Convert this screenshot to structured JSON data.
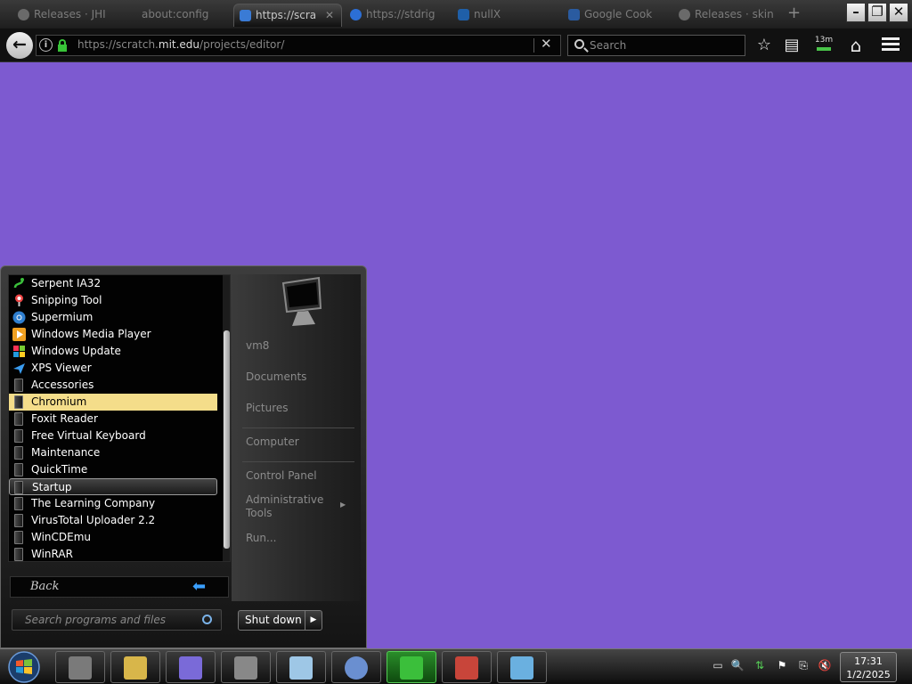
{
  "browser": {
    "tabs": [
      {
        "label": "Releases · JHI",
        "active": false,
        "icon_color": "#6a6a6a"
      },
      {
        "label": "about:config",
        "active": false,
        "icon_color": "#6a6a6a"
      },
      {
        "label": "https://scra",
        "active": true,
        "icon_color": "#3a7bd5"
      },
      {
        "label": "https://stdrig",
        "active": false,
        "icon_color": "#2c6fd6"
      },
      {
        "label": "nullX",
        "active": false,
        "icon_color": "#1f5fa8"
      },
      {
        "label": "Google Cook",
        "active": false,
        "icon_color": "#2a5ba0"
      },
      {
        "label": "Releases · skin",
        "active": false,
        "icon_color": "#6a6a6a"
      }
    ],
    "new_tab": "+",
    "window_controls": {
      "minimize": "–",
      "maximize": "❐",
      "close": "✕"
    },
    "nav": {
      "back": "←",
      "url_prefix": "https://scratch.",
      "url_host": "mit.edu",
      "url_path": "/projects/editor/",
      "clear": "✕",
      "search_placeholder": "Search",
      "bookmark": "☆",
      "reader": "▤",
      "timer_badge": "13m",
      "home": "⌂"
    }
  },
  "start_menu": {
    "programs": [
      {
        "label": "Serpent IA32",
        "icon": "serpent-icon"
      },
      {
        "label": "Snipping Tool",
        "icon": "scissors-icon"
      },
      {
        "label": "Supermium",
        "icon": "supermium-icon"
      },
      {
        "label": "Windows Media Player",
        "icon": "media-player-icon"
      },
      {
        "label": "Windows Update",
        "icon": "windows-update-icon"
      },
      {
        "label": "XPS Viewer",
        "icon": "xps-viewer-icon"
      },
      {
        "label": "Accessories",
        "icon": "folder-icon"
      },
      {
        "label": "Chromium",
        "icon": "folder-icon",
        "selected": true
      },
      {
        "label": "Foxit Reader",
        "icon": "folder-icon"
      },
      {
        "label": "Free Virtual Keyboard",
        "icon": "folder-icon"
      },
      {
        "label": "Maintenance",
        "icon": "folder-icon"
      },
      {
        "label": "QuickTime",
        "icon": "folder-icon"
      },
      {
        "label": "Startup",
        "icon": "folder-icon",
        "hover": true
      },
      {
        "label": "The Learning Company",
        "icon": "folder-icon"
      },
      {
        "label": "VirusTotal Uploader 2.2",
        "icon": "folder-icon"
      },
      {
        "label": "WinCDEmu",
        "icon": "folder-icon"
      },
      {
        "label": "WinRAR",
        "icon": "folder-icon"
      }
    ],
    "back_label": "Back",
    "search_placeholder": "Search programs and files",
    "shutdown_label": "Shut down",
    "shutdown_arrow": "▶",
    "right_links": {
      "user": "vm8",
      "documents": "Documents",
      "pictures": "Pictures",
      "computer": "Computer",
      "control_panel": "Control Panel",
      "admin_tools": "Administrative Tools",
      "admin_arrow": "▶",
      "run": "Run..."
    }
  },
  "taskbar": {
    "pinned": [
      {
        "name": "task-manager-icon",
        "color": "#7a7a7a"
      },
      {
        "name": "file-explorer-icon",
        "color": "#d8b64a"
      },
      {
        "name": "anime-avatar-icon",
        "color": "#7a6ad8"
      },
      {
        "name": "drive-icon",
        "color": "#888888"
      },
      {
        "name": "notepad-icon",
        "color": "#9ec7e6"
      },
      {
        "name": "chromium-icon",
        "color": "#6a8fd0"
      },
      {
        "name": "serpent-icon",
        "color": "#3bbf3b",
        "active": true
      },
      {
        "name": "archive-icon",
        "color": "#c8453a"
      },
      {
        "name": "image-viewer-icon",
        "color": "#6ab0e0"
      }
    ],
    "tray": {
      "show_desktop": "▭",
      "search": "🔍",
      "network": "⇅",
      "flag": "⚑",
      "devices": "⎘",
      "volume": "🔇"
    },
    "clock": {
      "time": "17:31",
      "date": "1/2/2025"
    }
  },
  "colors": {
    "page_background": "#7d5ad0",
    "selected_program": "#f4dd8a",
    "url_secure": "#38c438"
  }
}
